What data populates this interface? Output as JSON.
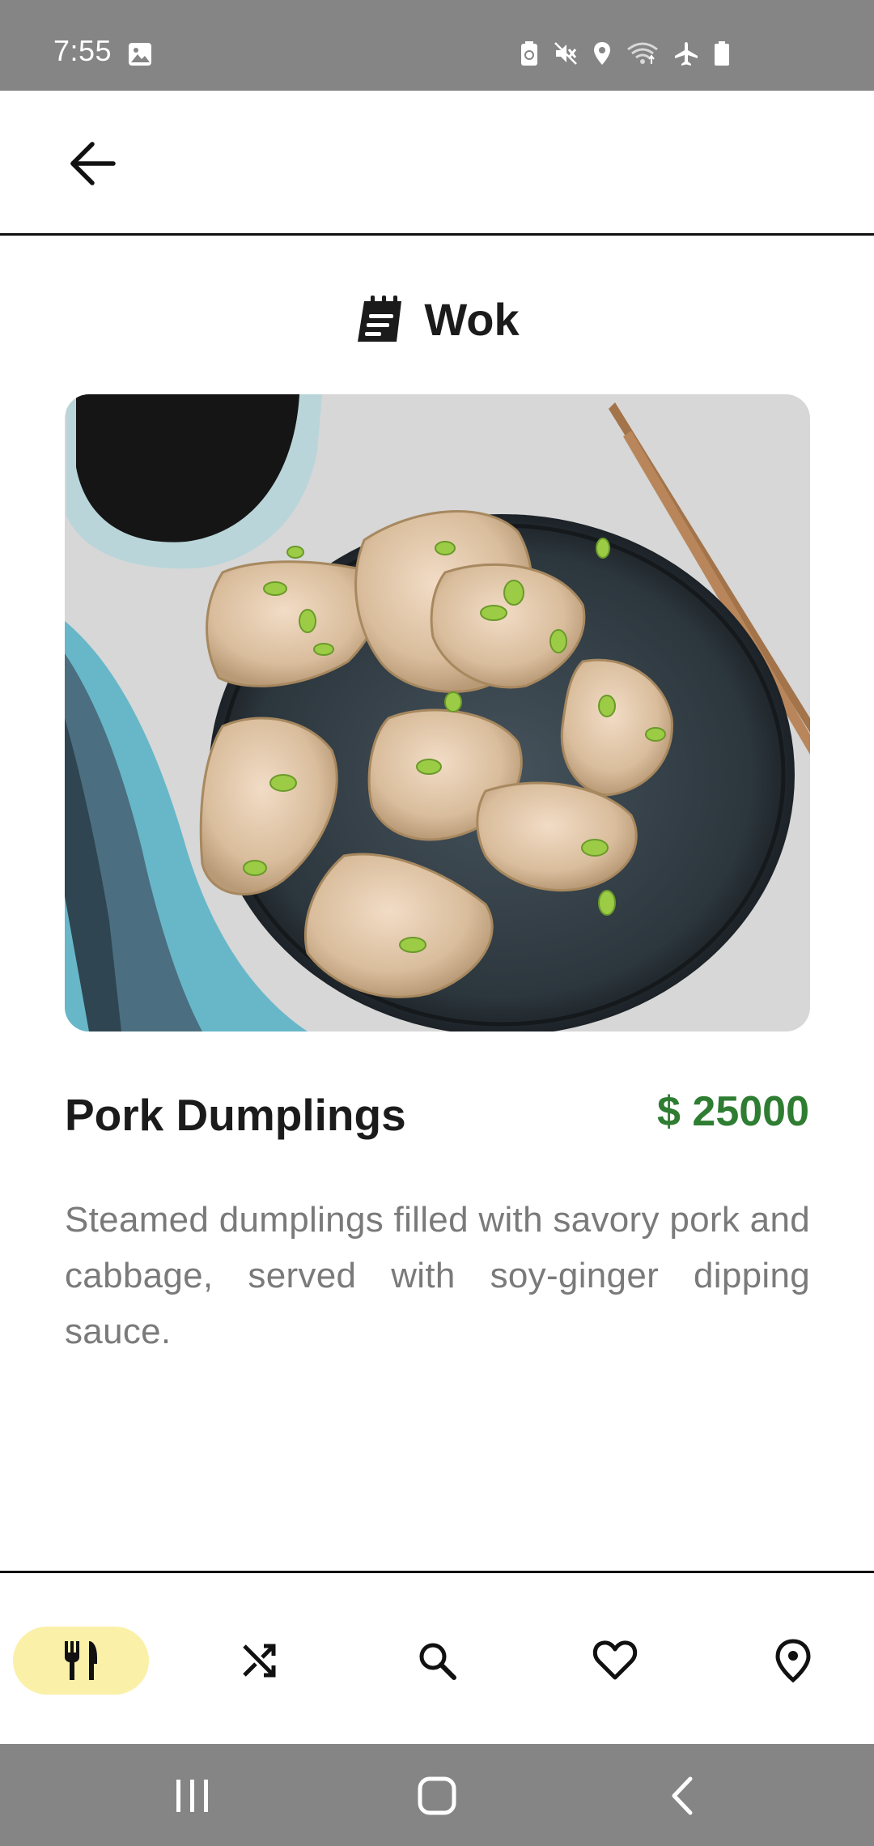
{
  "status_bar": {
    "time": "7:55",
    "icons": [
      "gallery-icon",
      "battery-saver-icon",
      "mute-icon",
      "location-icon",
      "wifi-icon",
      "airplane-icon",
      "battery-icon"
    ]
  },
  "header": {
    "back_icon": "arrow-left-icon"
  },
  "restaurant": {
    "icon": "notepad-icon",
    "name": "Wok"
  },
  "dish": {
    "image_subject": "dumplings-photo",
    "name": "Pork Dumplings",
    "price": "$ 25000",
    "description": "Steamed dumplings filled with savory pork and cabbage, served with soy-ginger dipping sauce."
  },
  "bottom_nav": {
    "items": [
      {
        "icon": "restaurant-icon",
        "active": true
      },
      {
        "icon": "shuffle-icon",
        "active": false
      },
      {
        "icon": "search-icon",
        "active": false
      },
      {
        "icon": "heart-icon",
        "active": false
      },
      {
        "icon": "location-pin-icon",
        "active": false
      }
    ],
    "active_bg": "#fbf0a8"
  },
  "colors": {
    "status_bar": "#858585",
    "price": "#2e7d32",
    "description": "#7a7a7a"
  }
}
